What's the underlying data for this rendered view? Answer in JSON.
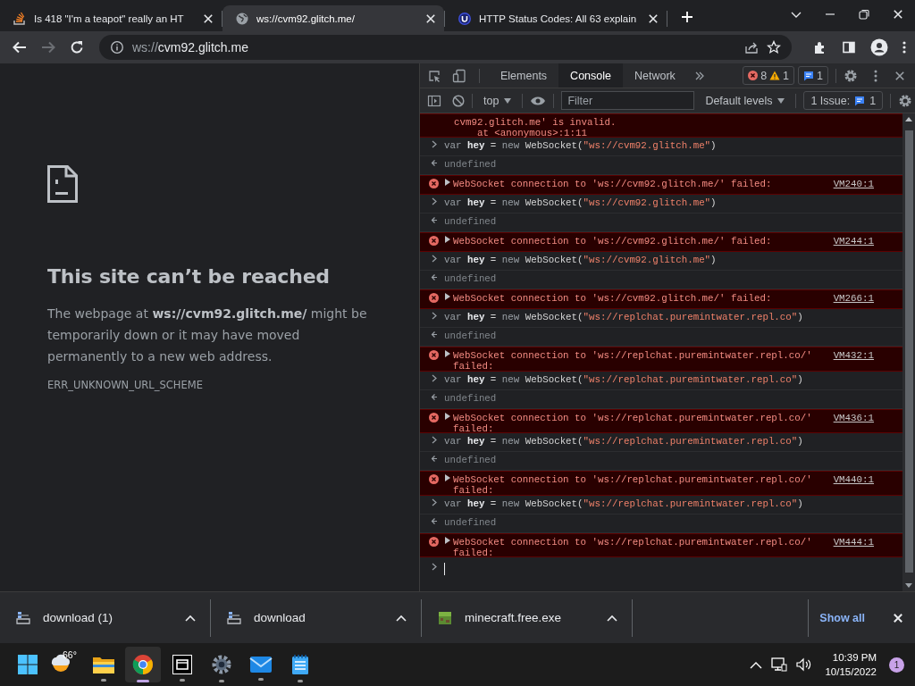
{
  "browser_tabs": [
    {
      "title": "Is 418 \"I'm a teapot\" really an HT",
      "kind": "stack",
      "selected": false
    },
    {
      "title": "ws://cvm92.glitch.me/",
      "kind": "globe",
      "selected": true
    },
    {
      "title": "HTTP Status Codes: All 63 explain",
      "kind": "circle",
      "selected": false
    }
  ],
  "navigation": [
    {
      "kind": "back",
      "disabled": false
    },
    {
      "kind": "forward",
      "disabled": true
    },
    {
      "kind": "reload",
      "disabled": false
    }
  ],
  "address_bar": {
    "scheme": "ws://",
    "host": "cvm92.glitch.me"
  },
  "error_page": {
    "title": "This site can’t be reached",
    "message": "The webpage at **ws://cvm92.glitch.me/** might be temporarily down or it may have moved permanently to a new web address.",
    "code": "ERR_UNKNOWN_URL_SCHEME"
  },
  "devtools": {
    "tabs": [
      {
        "label": "Elements",
        "selected": false
      },
      {
        "label": "Console",
        "selected": true
      },
      {
        "label": "Network",
        "selected": false
      }
    ],
    "error_count": "8",
    "warning_count": "1",
    "message_count": "1",
    "context": "top",
    "filter": {
      "placeholder": "Filter"
    },
    "levels": "Default levels",
    "issues": {
      "label": "1 Issue:",
      "count": "1"
    },
    "console": [
      {
        "kind": "error_tail",
        "lines": [
          "cvm92.glitch.me' is invalid.",
          "    at <anonymous>:1:11"
        ]
      },
      {
        "kind": "input",
        "tokens": [
          {
            "kind": "keyword",
            "text": "var "
          },
          {
            "kind": "name",
            "text": "hey"
          },
          {
            "kind": "plain",
            "text": " = "
          },
          {
            "kind": "keyword",
            "text": "new "
          },
          {
            "kind": "plain",
            "text": "WebSocket("
          },
          {
            "kind": "string",
            "text": "\"ws://cvm92.glitch.me\""
          },
          {
            "kind": "plain",
            "text": ")"
          }
        ]
      },
      {
        "kind": "output",
        "text": "undefined"
      },
      {
        "kind": "error",
        "text": "WebSocket connection to 'ws://cvm92.glitch.me/' failed:",
        "source": "VM240:1"
      },
      {
        "kind": "input",
        "tokens": [
          {
            "kind": "keyword",
            "text": "var "
          },
          {
            "kind": "name",
            "text": "hey"
          },
          {
            "kind": "plain",
            "text": " = "
          },
          {
            "kind": "keyword",
            "text": "new "
          },
          {
            "kind": "plain",
            "text": "WebSocket("
          },
          {
            "kind": "string",
            "text": "\"ws://cvm92.glitch.me\""
          },
          {
            "kind": "plain",
            "text": ")"
          }
        ]
      },
      {
        "kind": "output",
        "text": "undefined"
      },
      {
        "kind": "error",
        "text": "WebSocket connection to 'ws://cvm92.glitch.me/' failed:",
        "source": "VM244:1"
      },
      {
        "kind": "input",
        "tokens": [
          {
            "kind": "keyword",
            "text": "var "
          },
          {
            "kind": "name",
            "text": "hey"
          },
          {
            "kind": "plain",
            "text": " = "
          },
          {
            "kind": "keyword",
            "text": "new "
          },
          {
            "kind": "plain",
            "text": "WebSocket("
          },
          {
            "kind": "string",
            "text": "\"ws://cvm92.glitch.me\""
          },
          {
            "kind": "plain",
            "text": ")"
          }
        ]
      },
      {
        "kind": "output",
        "text": "undefined"
      },
      {
        "kind": "error",
        "text": "WebSocket connection to 'ws://cvm92.glitch.me/' failed:",
        "source": "VM266:1"
      },
      {
        "kind": "input",
        "tokens": [
          {
            "kind": "keyword",
            "text": "var "
          },
          {
            "kind": "name",
            "text": "hey"
          },
          {
            "kind": "plain",
            "text": " = "
          },
          {
            "kind": "keyword",
            "text": "new "
          },
          {
            "kind": "plain",
            "text": "WebSocket("
          },
          {
            "kind": "string",
            "text": "\"ws://replchat.puremintwater.repl.co\""
          },
          {
            "kind": "plain",
            "text": ")"
          }
        ]
      },
      {
        "kind": "output",
        "text": "undefined"
      },
      {
        "kind": "error",
        "text": "WebSocket connection to 'ws://replchat.puremintwater.repl.co/' failed:",
        "source": "VM432:1"
      },
      {
        "kind": "input",
        "tokens": [
          {
            "kind": "keyword",
            "text": "var "
          },
          {
            "kind": "name",
            "text": "hey"
          },
          {
            "kind": "plain",
            "text": " = "
          },
          {
            "kind": "keyword",
            "text": "new "
          },
          {
            "kind": "plain",
            "text": "WebSocket("
          },
          {
            "kind": "string",
            "text": "\"ws://replchat.puremintwater.repl.co\""
          },
          {
            "kind": "plain",
            "text": ")"
          }
        ]
      },
      {
        "kind": "output",
        "text": "undefined"
      },
      {
        "kind": "error",
        "text": "WebSocket connection to 'ws://replchat.puremintwater.repl.co/' failed:",
        "source": "VM436:1"
      },
      {
        "kind": "input",
        "tokens": [
          {
            "kind": "keyword",
            "text": "var "
          },
          {
            "kind": "name",
            "text": "hey"
          },
          {
            "kind": "plain",
            "text": " = "
          },
          {
            "kind": "keyword",
            "text": "new "
          },
          {
            "kind": "plain",
            "text": "WebSocket("
          },
          {
            "kind": "string",
            "text": "\"ws://replchat.puremintwater.repl.co\""
          },
          {
            "kind": "plain",
            "text": ")"
          }
        ]
      },
      {
        "kind": "output",
        "text": "undefined"
      },
      {
        "kind": "error",
        "text": "WebSocket connection to 'ws://replchat.puremintwater.repl.co/' failed:",
        "source": "VM440:1"
      },
      {
        "kind": "input",
        "tokens": [
          {
            "kind": "keyword",
            "text": "var "
          },
          {
            "kind": "name",
            "text": "hey"
          },
          {
            "kind": "plain",
            "text": " = "
          },
          {
            "kind": "keyword",
            "text": "new "
          },
          {
            "kind": "plain",
            "text": "WebSocket("
          },
          {
            "kind": "string",
            "text": "\"ws://replchat.puremintwater.repl.co\""
          },
          {
            "kind": "plain",
            "text": ")"
          }
        ]
      },
      {
        "kind": "output",
        "text": "undefined"
      },
      {
        "kind": "error",
        "text": "WebSocket connection to 'ws://replchat.puremintwater.repl.co/' failed:",
        "source": "VM444:1"
      },
      {
        "kind": "prompt"
      }
    ]
  },
  "downloads": [
    {
      "name": "download (1)",
      "kind": "file"
    },
    {
      "name": "download",
      "kind": "file"
    },
    {
      "name": "minecraft.free.exe",
      "kind": "block"
    }
  ],
  "show_all": "Show all",
  "taskbar": {
    "weather": "66°",
    "apps": [
      {
        "kind": "explorer",
        "selected": false
      },
      {
        "kind": "chrome",
        "selected": true
      },
      {
        "kind": "archiver",
        "selected": false
      },
      {
        "kind": "settings",
        "selected": false
      },
      {
        "kind": "mail",
        "selected": false
      },
      {
        "kind": "notepad",
        "selected": false
      }
    ],
    "time": "10:39 PM",
    "date": "10/15/2022",
    "notifications": "1"
  }
}
